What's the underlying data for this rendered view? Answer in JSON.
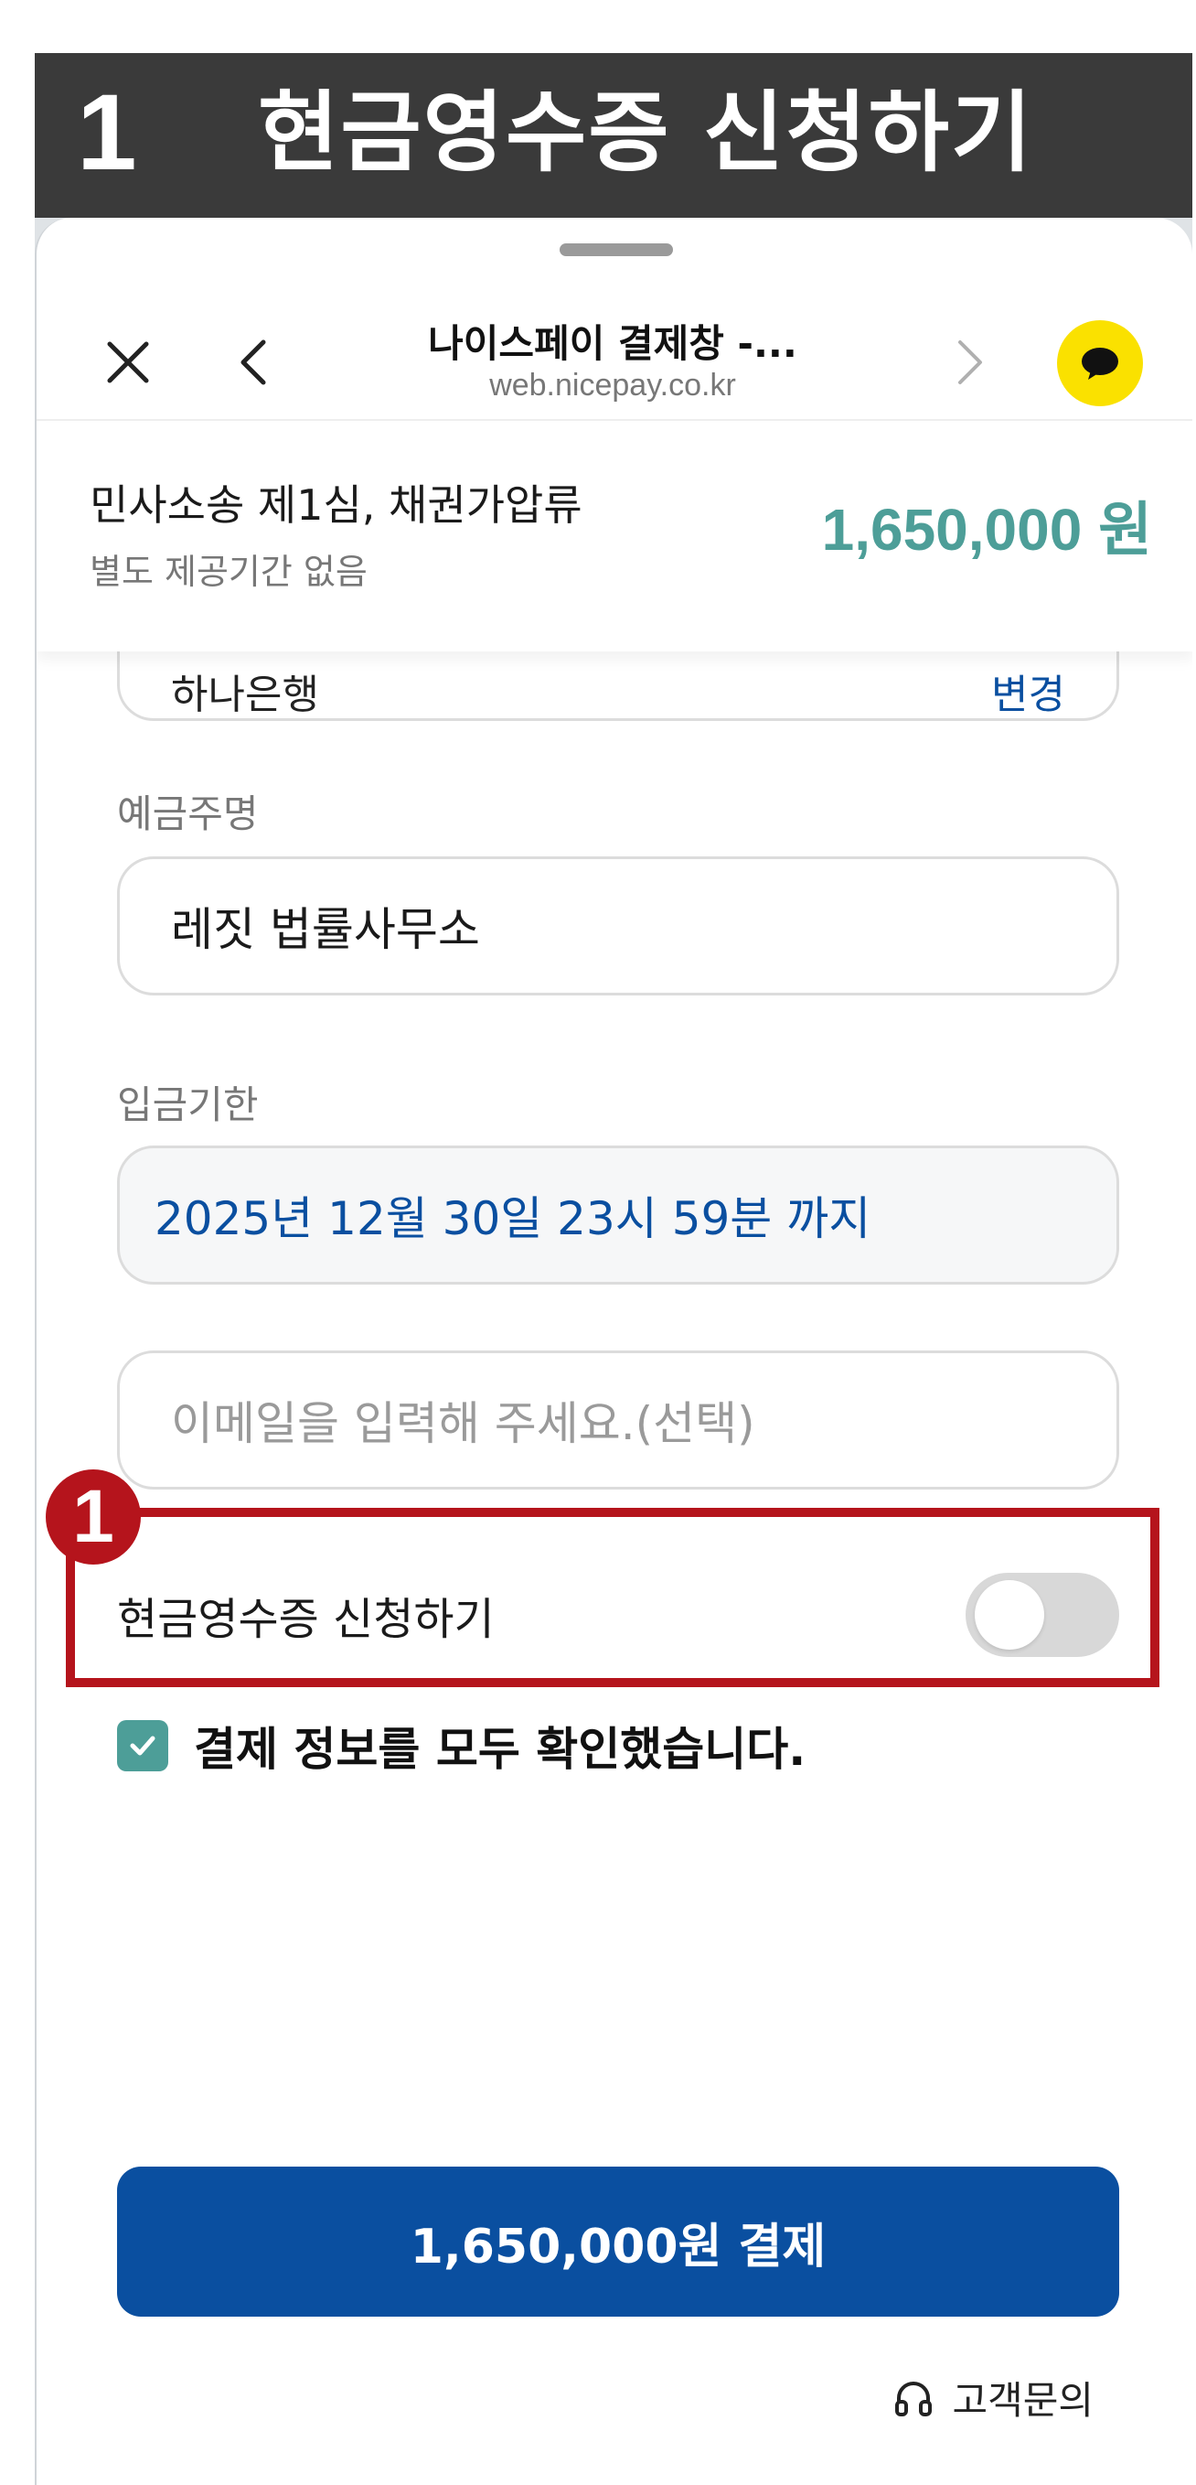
{
  "banner": {
    "step": "1",
    "title": "현금영수증 신청하기"
  },
  "nav": {
    "title": "나이스페이 결제창 -...",
    "url": "web.nicepay.co.kr",
    "icons": {
      "close": "close-icon",
      "back": "chevron-left-icon",
      "forward": "chevron-right-icon",
      "talk": "kakaotalk-icon"
    }
  },
  "order": {
    "name": "민사소송 제1심, 채권가압류",
    "period": "별도 제공기간 없음",
    "amount": "1,650,000 원"
  },
  "bank_peek": {
    "value": "하나은행",
    "action": "변경"
  },
  "depositor": {
    "label": "예금주명",
    "value": "레짓 법률사무소"
  },
  "deadline": {
    "label": "입금기한",
    "value": "2025년 12월 30일 23시 59분 까지"
  },
  "email": {
    "placeholder": "이메일을 입력해 주세요.(선택)"
  },
  "cash_receipt": {
    "label": "현금영수증 신청하기",
    "enabled": false
  },
  "annotation": {
    "badge": "1",
    "color": "#b5141c"
  },
  "confirm": {
    "label": "결제 정보를 모두 확인했습니다.",
    "checked": true
  },
  "pay_button": {
    "label": "1,650,000원 결제"
  },
  "support": {
    "label": "고객문의",
    "icon": "headset-icon"
  },
  "colors": {
    "accent": "#4d9e98",
    "primary": "#0a4fa0",
    "kakao": "#fae100"
  }
}
